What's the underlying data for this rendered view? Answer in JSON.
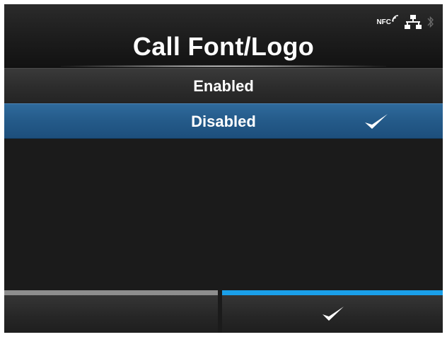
{
  "header": {
    "title": "Call Font/Logo",
    "nfc_label": "NFC"
  },
  "list": {
    "items": [
      {
        "label": "Enabled",
        "selected": false
      },
      {
        "label": "Disabled",
        "selected": true
      }
    ]
  },
  "icons": {
    "nfc": "nfc-icon",
    "network": "network-icon",
    "bluetooth": "bluetooth-icon",
    "check": "check-icon"
  },
  "colors": {
    "background": "#1b1b1b",
    "selected_row": "#245a89",
    "accent": "#1aa0ea",
    "inactive_key": "#8e8e8e",
    "text": "#ffffff"
  }
}
